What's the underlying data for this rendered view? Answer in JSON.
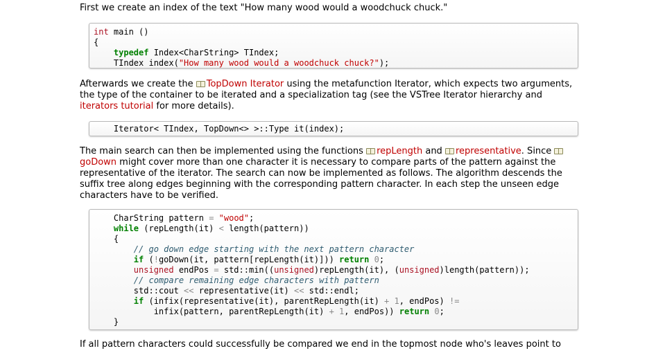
{
  "para1": "First we create an index of the text \"How many wood would a woodchuck chuck.\"",
  "code1": {
    "lines": [
      {
        "indent": 0,
        "tokens": [
          {
            "t": "int",
            "c": "ty"
          },
          {
            "t": " main ()",
            "c": "plain"
          }
        ]
      },
      {
        "indent": 0,
        "tokens": [
          {
            "t": "{",
            "c": "plain"
          }
        ]
      },
      {
        "indent": 4,
        "tokens": [
          {
            "t": "typedef",
            "c": "kw"
          },
          {
            "t": " Index<CharString> TIndex;",
            "c": "plain"
          }
        ]
      },
      {
        "indent": 4,
        "tokens": [
          {
            "t": "TIndex index(",
            "c": "plain"
          },
          {
            "t": "\"How many wood would a woodchuck chuck?\"",
            "c": "str"
          },
          {
            "t": ");",
            "c": "plain"
          }
        ]
      }
    ]
  },
  "para2": {
    "t1": "Afterwards we create the ",
    "link1": "TopDown Iterator",
    "t2": " using the metafunction Iterator, which expects two arguments, the type of the container to be iterated and a specialization tag (see the VSTree Iterator hierarchy and ",
    "link2": "iterators tutorial",
    "t3": " for more details)."
  },
  "code2": {
    "lines": [
      {
        "indent": 4,
        "tokens": [
          {
            "t": "Iterator< TIndex, TopDown<> >::Type it(index);",
            "c": "plain"
          }
        ]
      }
    ]
  },
  "para3": {
    "t1": "The main search can then be implemented using the functions ",
    "link1": "repLength",
    "t2": " and ",
    "link2": "representative",
    "t3": ". Since ",
    "link3": "goDown",
    "t4": " might cover more than one character it is necessary to compare parts of the pattern against the representative of the iterator. The search can now be implemented as follows. The algorithm descends the suffix tree along edges beginning with the corresponding pattern character. In each step the unseen edge characters have to be verified."
  },
  "code3": {
    "lines": [
      {
        "indent": 4,
        "tokens": [
          {
            "t": "CharString pattern ",
            "c": "plain"
          },
          {
            "t": "=",
            "c": "op"
          },
          {
            "t": " ",
            "c": "plain"
          },
          {
            "t": "\"wood\"",
            "c": "str"
          },
          {
            "t": ";",
            "c": "plain"
          }
        ]
      },
      {
        "indent": 4,
        "tokens": [
          {
            "t": "while",
            "c": "kw"
          },
          {
            "t": " (repLength(it) ",
            "c": "plain"
          },
          {
            "t": "<",
            "c": "op"
          },
          {
            "t": " length(pattern))",
            "c": "plain"
          }
        ]
      },
      {
        "indent": 4,
        "tokens": [
          {
            "t": "{",
            "c": "plain"
          }
        ]
      },
      {
        "indent": 8,
        "tokens": [
          {
            "t": "// go down edge starting with the next pattern character",
            "c": "cmt"
          }
        ]
      },
      {
        "indent": 8,
        "tokens": [
          {
            "t": "if",
            "c": "kw"
          },
          {
            "t": " (",
            "c": "plain"
          },
          {
            "t": "!",
            "c": "op"
          },
          {
            "t": "goDown(it, pattern[repLength(it)])) ",
            "c": "plain"
          },
          {
            "t": "return",
            "c": "kw"
          },
          {
            "t": " ",
            "c": "plain"
          },
          {
            "t": "0",
            "c": "num"
          },
          {
            "t": ";",
            "c": "plain"
          }
        ]
      },
      {
        "indent": 8,
        "tokens": [
          {
            "t": "unsigned",
            "c": "ty"
          },
          {
            "t": " endPos ",
            "c": "plain"
          },
          {
            "t": "=",
            "c": "op"
          },
          {
            "t": " std::min((",
            "c": "plain"
          },
          {
            "t": "unsigned",
            "c": "ty"
          },
          {
            "t": ")repLength(it), (",
            "c": "plain"
          },
          {
            "t": "unsigned",
            "c": "ty"
          },
          {
            "t": ")length(pattern));",
            "c": "plain"
          }
        ]
      },
      {
        "indent": 8,
        "tokens": [
          {
            "t": "// compare remaining edge characters with pattern",
            "c": "cmt"
          }
        ]
      },
      {
        "indent": 8,
        "tokens": [
          {
            "t": "std::cout ",
            "c": "plain"
          },
          {
            "t": "<<",
            "c": "op"
          },
          {
            "t": " representative(it) ",
            "c": "plain"
          },
          {
            "t": "<<",
            "c": "op"
          },
          {
            "t": " std::endl;",
            "c": "plain"
          }
        ]
      },
      {
        "indent": 8,
        "tokens": [
          {
            "t": "if",
            "c": "kw"
          },
          {
            "t": " (infix(representative(it), parentRepLength(it) ",
            "c": "plain"
          },
          {
            "t": "+",
            "c": "op"
          },
          {
            "t": " ",
            "c": "plain"
          },
          {
            "t": "1",
            "c": "num"
          },
          {
            "t": ", endPos) ",
            "c": "plain"
          },
          {
            "t": "!=",
            "c": "op"
          }
        ]
      },
      {
        "indent": 12,
        "tokens": [
          {
            "t": "infix(pattern, parentRepLength(it) ",
            "c": "plain"
          },
          {
            "t": "+",
            "c": "op"
          },
          {
            "t": " ",
            "c": "plain"
          },
          {
            "t": "1",
            "c": "num"
          },
          {
            "t": ", endPos)) ",
            "c": "plain"
          },
          {
            "t": "return",
            "c": "kw"
          },
          {
            "t": " ",
            "c": "plain"
          },
          {
            "t": "0",
            "c": "num"
          },
          {
            "t": ";",
            "c": "plain"
          }
        ]
      },
      {
        "indent": 4,
        "tokens": [
          {
            "t": "}",
            "c": "plain"
          }
        ]
      }
    ]
  },
  "para4": "If all pattern characters could successfully be compared we end in the topmost node who's leaves point to"
}
